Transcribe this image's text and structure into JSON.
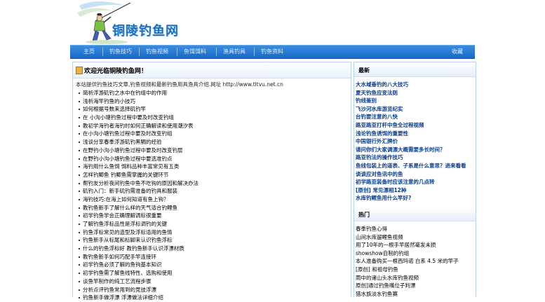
{
  "site": {
    "name": "铜陵钓鱼网"
  },
  "nav": {
    "items": [
      "主页",
      "钓鱼技巧",
      "钓鱼视频",
      "鱼饵饵料",
      "渔具钓具",
      "钓鱼资料"
    ],
    "favorite": "收藏"
  },
  "main": {
    "title": "欢迎光临铜陵钓鱼网！",
    "intro": "本站提供钓鱼技巧文章,钓鱼视频和最新钓鱼用具渔具介绍.网址 http://www.tltvu.net.cn",
    "articles": [
      "简析浮游矶钓之水中在钓组中的作用",
      "浅析海竿钓鱼的小技巧",
      "如何根据号数来选择矶钓竿",
      "在 小沟小塘钓鱼过程中要及时改变钓组",
      "教初学海钓者海钓时如何正确解读和使用潮汐表",
      "在小沟小塘钓鱼过程中要及时改变钓组",
      "浅谈分享春季浮游矶钓黑鲷的经验",
      "在野钓小沟小塘钓鱼过程中要及时改变钓层",
      "在野钓小沟小塘钓鱼过程中要选准钓点",
      "海钓用什么鱼饵 饵料品种丰富常见有五类",
      "怎样钓鲫鱼 钓鲫鱼需掌握的关键环节",
      "帮钓友分析夜间钓鱼中鱼不吃钩的原因和解决办法",
      "矶钓入门：新手矶钓需准备的钓具和服装",
      "海钓技巧:在海上如何知道有鱼上钩？",
      "教钓鱼新手了解什么样的天气适合钓鲤鱼",
      "初学钓鱼学会正确理解调标很重要",
      "了解钓鱼浮标品性是浮标调钓的关键",
      "钓鱼浮标常见的造型及浮标适用的鱼情",
      "钓鱼新手从标尾和标脚来认识钓鱼浮标",
      "什么的钓鱼浮标好 教钓鱼新手认识浮漂材质",
      "教钓鱼新手如何巧配手竿连接环",
      "初学钓鱼必须了解的鱼钩基本知识",
      "初学钓鱼需了解鱼线特性、选购和使用",
      "谈鱼竿制作的纯工艺流程步骤",
      "分析点评钓鱼常用到的竞技浮漂",
      "钓鱼新手做浮漂 浮漂做法详细介绍"
    ]
  },
  "latest": {
    "title": "最新",
    "items": [
      "大水域垂钓的八大技巧",
      "夏天钓鱼应变法则",
      "钓线鉴别",
      "飞沙河水库游览纪实",
      "台钓要注意的八快",
      "路亚路亚打杆中鱼全过程视频",
      "浅论钓鱼诱饵的重要性",
      "中国银行外汇牌价",
      "请问你们大家调漂大概需要多长时间？",
      "路亚钓法的操作技巧",
      "鱼线包装上的道表、子系是什么意思？进来看看",
      "谈谈应对鱼讯中的鱼",
      "初学路亚装备时应该注意的几点转",
      "[原创] 常见漂相12种",
      "水库钓鲤鱼用什么竿好?"
    ]
  },
  "hot": {
    "title": "热门",
    "items": [
      "春季钓鱼心得",
      "山间水库遛鲤鱼视频",
      "用了10年的一根手竿居然毫发未损",
      "showshow自制的钓组",
      "本人准备购买一根西玛诺  白系 4.5 米的竿子",
      "[原创] 和祖母钓鱼",
      "雨中的诸山头水库钓鱼视频",
      "原创]通过钓鱼嘴位子判漂",
      "猎水族淡水钓鱼赛"
    ]
  },
  "colors": {
    "nav": "#1768c9",
    "latest_link": "#0a3d8f",
    "border": "#b9d2ec"
  }
}
